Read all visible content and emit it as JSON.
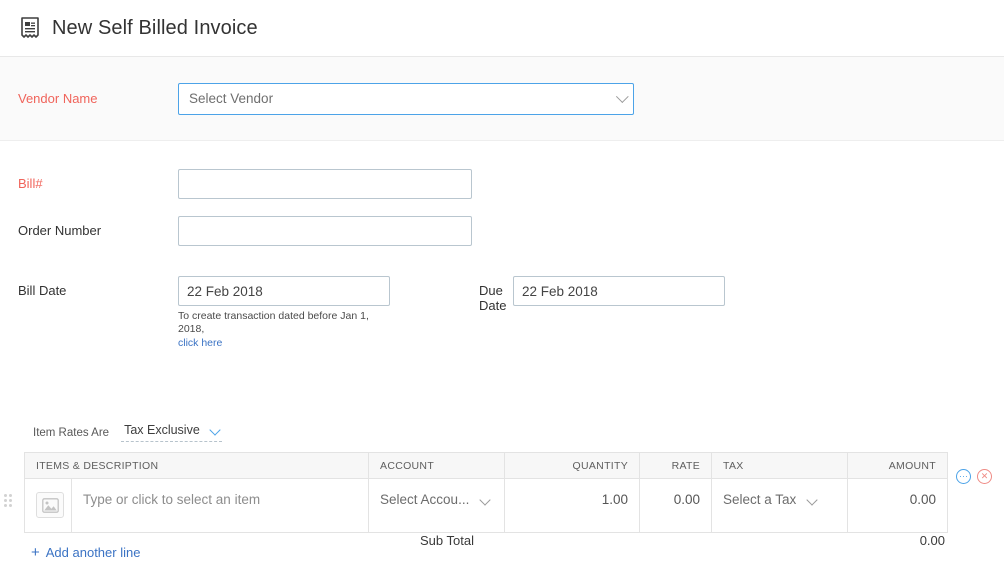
{
  "header": {
    "icon": "invoice-icon",
    "title": "New Self Billed Invoice"
  },
  "vendor": {
    "label": "Vendor Name",
    "placeholder": "Select Vendor",
    "required_color": "#f0645b",
    "focus_border_color": "#4ca3e8"
  },
  "form": {
    "bill_number": {
      "label": "Bill#",
      "value": "",
      "placeholder": ""
    },
    "order_number": {
      "label": "Order Number",
      "value": "",
      "placeholder": ""
    },
    "bill_date": {
      "label": "Bill Date",
      "value": "22 Feb 2018",
      "hint_text": "To create transaction dated before Jan 1, 2018,",
      "hint_link": "click here"
    },
    "due_date": {
      "label": "Due Date",
      "value": "22 Feb 2018"
    }
  },
  "item_rates": {
    "label": "Item Rates Are",
    "selected": "Tax Exclusive"
  },
  "items_table": {
    "columns": [
      "ITEMS & DESCRIPTION",
      "ACCOUNT",
      "QUANTITY",
      "RATE",
      "TAX",
      "AMOUNT"
    ],
    "rows": [
      {
        "thumbnail": "image-placeholder-icon",
        "item_placeholder": "Type or click to select an item",
        "account": "Select Accou...",
        "quantity": "1.00",
        "rate": "0.00",
        "tax": "Select a Tax",
        "amount": "0.00"
      }
    ],
    "row_actions": {
      "more": "···",
      "delete": "✕"
    }
  },
  "footer": {
    "add_line": "Add another line",
    "add_line_plus": "+",
    "subtotal_label": "Sub Total",
    "subtotal_value": "0.00"
  }
}
